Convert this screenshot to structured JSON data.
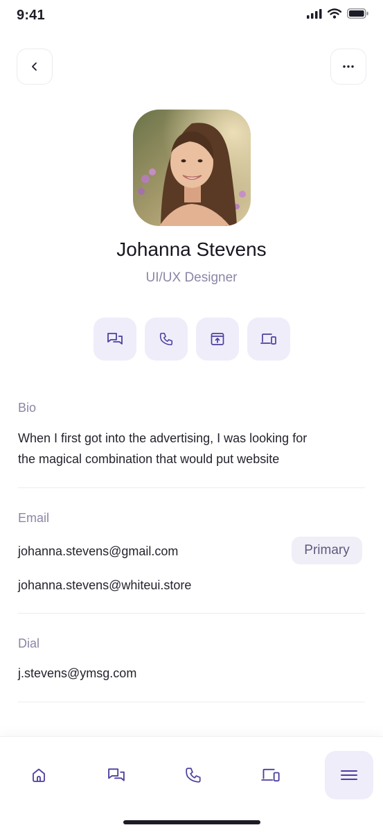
{
  "status_bar": {
    "time": "9:41"
  },
  "profile": {
    "name": "Johanna Stevens",
    "role": "UI/UX Designer"
  },
  "bio": {
    "label": "Bio",
    "line1": "When I first got into the advertising, I was looking for",
    "line2": "the magical combination that would put website"
  },
  "email": {
    "label": "Email",
    "primary": "johanna.stevens@gmail.com",
    "primary_badge": "Primary",
    "secondary": "johanna.stevens@whiteui.store"
  },
  "dial": {
    "label": "Dial",
    "value": "j.stevens@ymsg.com"
  },
  "actions": [
    "chat-icon",
    "phone-icon",
    "share-screen-icon",
    "devices-icon"
  ],
  "bottom_nav": {
    "items": [
      "home-icon",
      "chat-icon",
      "phone-icon",
      "devices-icon",
      "menu-icon"
    ],
    "active_index": 4
  },
  "colors": {
    "accent": "#4b3f9e",
    "accent_bg": "#efedfa",
    "muted_text": "#8a86a6"
  }
}
